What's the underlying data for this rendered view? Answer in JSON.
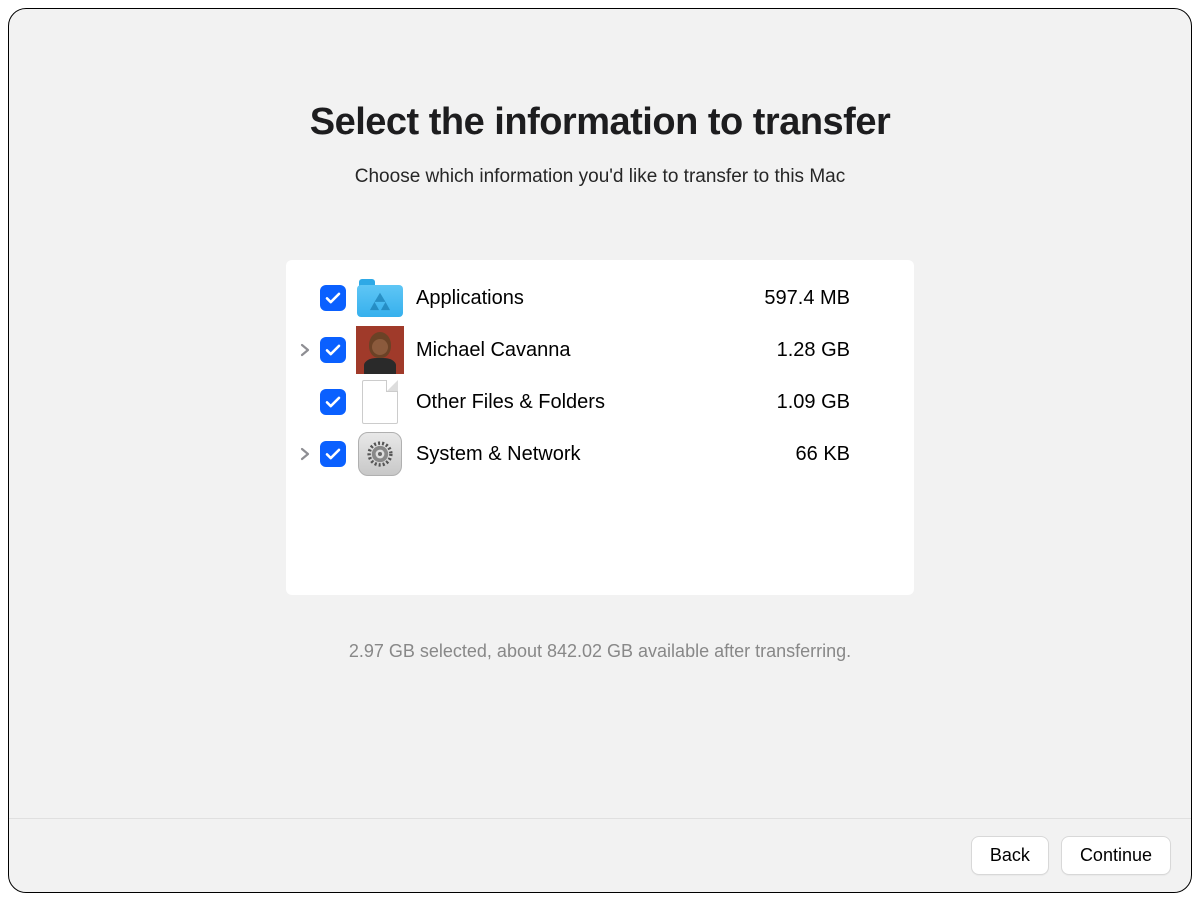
{
  "header": {
    "title": "Select the information to transfer",
    "subtitle": "Choose which information you'd like to transfer to this Mac"
  },
  "items": [
    {
      "label": "Applications",
      "size": "597.4 MB",
      "checked": true,
      "expandable": false,
      "icon": "applications-folder"
    },
    {
      "label": "Michael Cavanna",
      "size": "1.28 GB",
      "checked": true,
      "expandable": true,
      "icon": "user-avatar"
    },
    {
      "label": "Other Files & Folders",
      "size": "1.09 GB",
      "checked": true,
      "expandable": false,
      "icon": "generic-file"
    },
    {
      "label": "System & Network",
      "size": "66 KB",
      "checked": true,
      "expandable": true,
      "icon": "system-settings"
    }
  ],
  "status": "2.97 GB selected, about 842.02 GB available after transferring.",
  "footer": {
    "back": "Back",
    "continue": "Continue"
  }
}
